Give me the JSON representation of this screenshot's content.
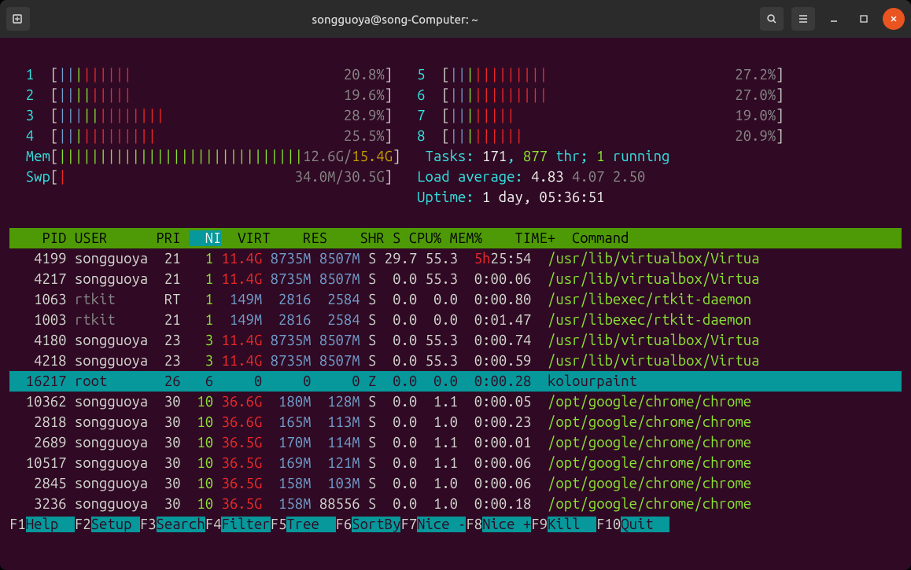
{
  "window": {
    "title": "songguoya@song-Computer: ~"
  },
  "cpu_meters": [
    {
      "core": "1",
      "pct": "20.8%"
    },
    {
      "core": "2",
      "pct": "19.6%"
    },
    {
      "core": "3",
      "pct": "28.9%"
    },
    {
      "core": "4",
      "pct": "25.5%"
    },
    {
      "core": "5",
      "pct": "27.2%"
    },
    {
      "core": "6",
      "pct": "27.0%"
    },
    {
      "core": "7",
      "pct": "19.0%"
    },
    {
      "core": "8",
      "pct": "20.9%"
    }
  ],
  "mem": {
    "label": "Mem",
    "used": "12.6G",
    "sep": "/",
    "total": "15.4G"
  },
  "swp": {
    "label": "Swp",
    "text": "34.0M/30.5G"
  },
  "tasks": {
    "label": "Tasks: ",
    "procs": "171",
    "sep1": ", ",
    "thr": "877",
    "thr_txt": " thr; ",
    "running": "1",
    "running_txt": " running"
  },
  "load": {
    "label": "Load average: ",
    "v1": "4.83",
    "v2": "4.07",
    "v3": "2.50"
  },
  "uptime": {
    "label": "Uptime: ",
    "value": "1 day, 05:36:51"
  },
  "columns": {
    "pid": "PID",
    "user": "USER",
    "pri": "PRI",
    "ni": "NI",
    "virt": "VIRT",
    "res": "RES",
    "shr": "SHR",
    "s": "S",
    "cpu": "CPU%",
    "mem": "MEM%",
    "time": "TIME+",
    "cmd": "Command"
  },
  "rows": [
    {
      "pid": "4199",
      "user": "songguoya",
      "pri": "21",
      "ni": "1",
      "virt": "11.4G",
      "res": "8735M",
      "shr": "8507M",
      "s": "S",
      "cpu": "29.7",
      "mem": "55.3",
      "time": "5h25:54",
      "time_hot": "5h",
      "cmd": "/usr/lib/virtualbox/Virtua",
      "virt_hot": true
    },
    {
      "pid": "4217",
      "user": "songguoya",
      "pri": "21",
      "ni": "1",
      "virt": "11.4G",
      "res": "8735M",
      "shr": "8507M",
      "s": "S",
      "cpu": "0.0",
      "mem": "55.3",
      "time": "0:00.06",
      "cmd": "/usr/lib/virtualbox/Virtua",
      "virt_hot": true
    },
    {
      "pid": "1063",
      "user": "rtkit",
      "pri": "RT",
      "ni": "1",
      "virt": "149M",
      "res": "2816",
      "shr": "2584",
      "s": "S",
      "cpu": "0.0",
      "mem": "0.0",
      "time": "0:00.80",
      "cmd": "/usr/libexec/rtkit-daemon",
      "virt_hot": false,
      "user_grey": true
    },
    {
      "pid": "1003",
      "user": "rtkit",
      "pri": "21",
      "ni": "1",
      "virt": "149M",
      "res": "2816",
      "shr": "2584",
      "s": "S",
      "cpu": "0.0",
      "mem": "0.0",
      "time": "0:01.47",
      "cmd": "/usr/libexec/rtkit-daemon",
      "virt_hot": false,
      "user_grey": true
    },
    {
      "pid": "4180",
      "user": "songguoya",
      "pri": "23",
      "ni": "3",
      "virt": "11.4G",
      "res": "8735M",
      "shr": "8507M",
      "s": "S",
      "cpu": "0.0",
      "mem": "55.3",
      "time": "0:00.74",
      "cmd": "/usr/lib/virtualbox/Virtua",
      "virt_hot": true
    },
    {
      "pid": "4218",
      "user": "songguoya",
      "pri": "23",
      "ni": "3",
      "virt": "11.4G",
      "res": "8735M",
      "shr": "8507M",
      "s": "S",
      "cpu": "0.0",
      "mem": "55.3",
      "time": "0:00.59",
      "cmd": "/usr/lib/virtualbox/Virtua",
      "virt_hot": true
    },
    {
      "pid": "16217",
      "user": "root",
      "pri": "26",
      "ni": "6",
      "virt": "0",
      "res": "0",
      "shr": "0",
      "s": "Z",
      "cpu": "0.0",
      "mem": "0.0",
      "time": "0:00.28",
      "cmd": "kolourpaint",
      "sel": true
    },
    {
      "pid": "10362",
      "user": "songguoya",
      "pri": "30",
      "ni": "10",
      "virt": "36.6G",
      "res": "180M",
      "shr": "128M",
      "s": "S",
      "cpu": "0.0",
      "mem": "1.1",
      "time": "0:00.05",
      "cmd": "/opt/google/chrome/chrome",
      "virt_hot": true
    },
    {
      "pid": "2818",
      "user": "songguoya",
      "pri": "30",
      "ni": "10",
      "virt": "36.6G",
      "res": "165M",
      "shr": "113M",
      "s": "S",
      "cpu": "0.0",
      "mem": "1.0",
      "time": "0:00.23",
      "cmd": "/opt/google/chrome/chrome",
      "virt_hot": true
    },
    {
      "pid": "2689",
      "user": "songguoya",
      "pri": "30",
      "ni": "10",
      "virt": "36.5G",
      "res": "170M",
      "shr": "114M",
      "s": "S",
      "cpu": "0.0",
      "mem": "1.1",
      "time": "0:00.01",
      "cmd": "/opt/google/chrome/chrome",
      "virt_hot": true
    },
    {
      "pid": "10517",
      "user": "songguoya",
      "pri": "30",
      "ni": "10",
      "virt": "36.5G",
      "res": "169M",
      "shr": "121M",
      "s": "S",
      "cpu": "0.0",
      "mem": "1.1",
      "time": "0:00.06",
      "cmd": "/opt/google/chrome/chrome",
      "virt_hot": true
    },
    {
      "pid": "2845",
      "user": "songguoya",
      "pri": "30",
      "ni": "10",
      "virt": "36.5G",
      "res": "158M",
      "shr": "103M",
      "s": "S",
      "cpu": "0.0",
      "mem": "1.0",
      "time": "0:00.06",
      "cmd": "/opt/google/chrome/chrome",
      "virt_hot": true
    },
    {
      "pid": "3236",
      "user": "songguoya",
      "pri": "30",
      "ni": "10",
      "virt": "36.5G",
      "res": "158M",
      "shr": "88556",
      "s": "S",
      "cpu": "0.0",
      "mem": "1.0",
      "time": "0:00.18",
      "cmd": "/opt/google/chrome/chrome",
      "virt_hot": true,
      "shr_plain": true
    }
  ],
  "fkeys": [
    {
      "k": "F1",
      "l": "Help  "
    },
    {
      "k": "F2",
      "l": "Setup "
    },
    {
      "k": "F3",
      "l": "Search"
    },
    {
      "k": "F4",
      "l": "Filter"
    },
    {
      "k": "F5",
      "l": "Tree  "
    },
    {
      "k": "F6",
      "l": "SortBy"
    },
    {
      "k": "F7",
      "l": "Nice -"
    },
    {
      "k": "F8",
      "l": "Nice +"
    },
    {
      "k": "F9",
      "l": "Kill  "
    },
    {
      "k": "F10",
      "l": "Quit  "
    }
  ]
}
